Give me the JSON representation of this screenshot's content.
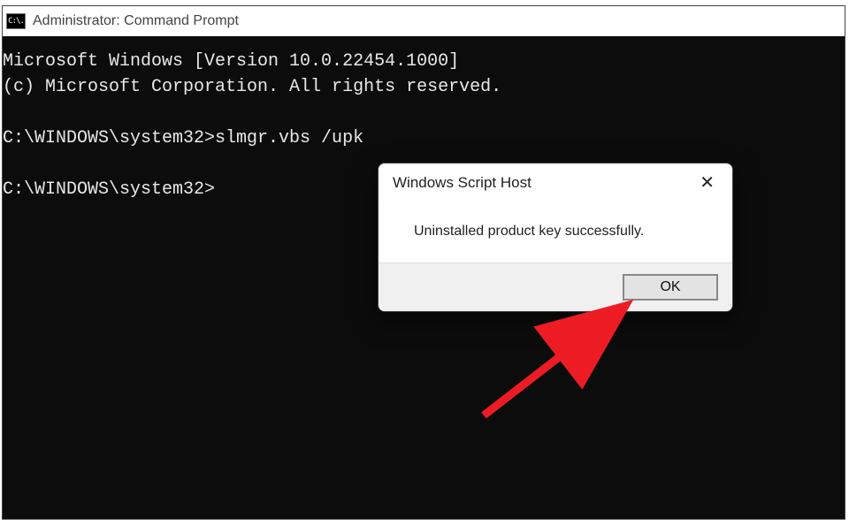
{
  "window": {
    "title": "Administrator: Command Prompt",
    "app_icon_label": "C:\\."
  },
  "terminal": {
    "line1": "Microsoft Windows [Version 10.0.22454.1000]",
    "line2": "(c) Microsoft Corporation. All rights reserved.",
    "blank": "",
    "prompt1": "C:\\WINDOWS\\system32>slmgr.vbs /upk",
    "prompt2": "C:\\WINDOWS\\system32>"
  },
  "dialog": {
    "title": "Windows Script Host",
    "message": "Uninstalled product key successfully.",
    "ok_label": "OK",
    "close_label": "✕"
  },
  "annotation": {
    "arrow_color": "#ed1c24"
  }
}
